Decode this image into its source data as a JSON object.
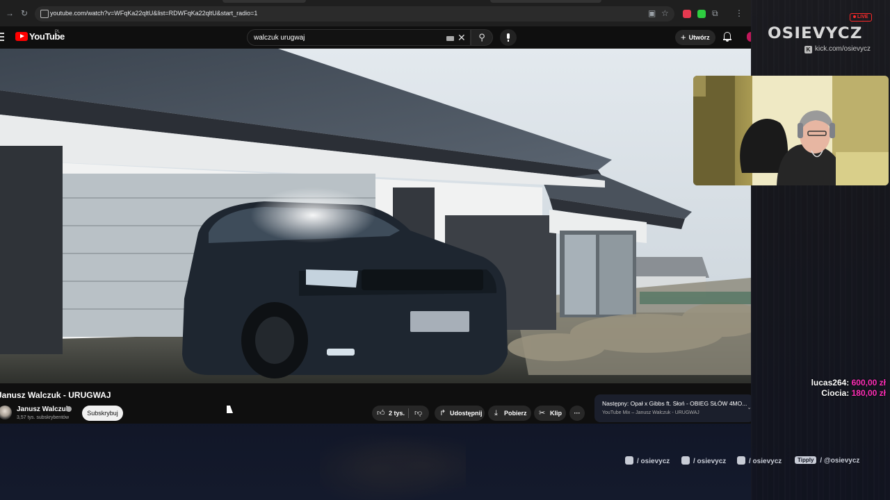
{
  "browser": {
    "url": "youtube.com/watch?v=WFqKa22qltU&list=RDWFqKa22qltU&start_radio=1"
  },
  "youtube": {
    "wordmark": "YouTube",
    "country": "PL",
    "search": {
      "query": "walczuk urugwaj"
    },
    "create_label": "Utwórz",
    "video": {
      "title": "Janusz Walczuk - URUGWAJ"
    },
    "channel": {
      "name": "Janusz Walczuk",
      "subscribers": "3,57 tys. subskrybentów",
      "subscribe_label": "Subskrybuj"
    },
    "actions": {
      "likes": "2 tys.",
      "share": "Udostępnij",
      "download": "Pobierz",
      "clip": "Klip"
    },
    "next": {
      "line1": "Następny: Opał x Gibbs ft. Słoń - OBIEG SŁÓW 4MO...",
      "line2": "YouTube Mix – Janusz Walczuk - URUGWAJ"
    }
  },
  "overlay": {
    "live_label": "LIVE",
    "brand": "OSIEVYCZ",
    "kick_link": "kick.com/osievycz",
    "donations": [
      {
        "name": "lucas264:",
        "amount": "600,00 zł"
      },
      {
        "name": "Ciocia:",
        "amount": "180,00 zł"
      }
    ],
    "socials": {
      "instagram": "/ osievycz",
      "tiktok": "/ osievycz",
      "youtube": "/ osievycz",
      "tipply_label": "Tipply",
      "tipply": "/ @osievycz"
    }
  },
  "colors": {
    "donation_amount": "#ff2fb8",
    "live": "#ff2a2a",
    "youtube_red": "#ff0000"
  }
}
